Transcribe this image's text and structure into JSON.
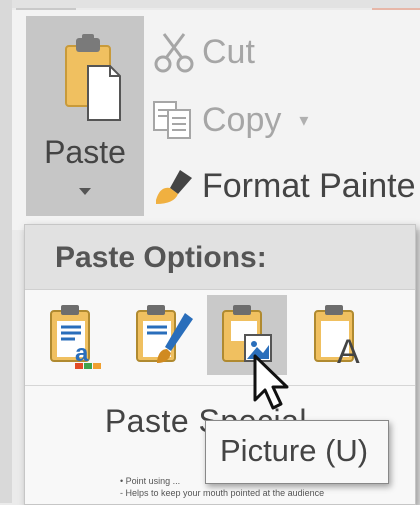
{
  "clipboard": {
    "paste_label": "Paste",
    "cut_label": "Cut",
    "copy_label": "Copy",
    "format_painter_label": "Format Painte"
  },
  "paste_menu": {
    "header": "Paste Options:",
    "options": [
      {
        "icon": "use-destination-theme-icon"
      },
      {
        "icon": "keep-source-formatting-icon"
      },
      {
        "icon": "picture-icon",
        "selected": true
      },
      {
        "icon": "keep-text-only-icon"
      }
    ],
    "paste_special_label": "Paste Special..."
  },
  "tooltip": {
    "text": "Picture (U)"
  },
  "background_slide": {
    "line1": "• Point using ...",
    "line2": "- Helps to keep your mouth pointed at the audience"
  },
  "colors": {
    "ribbon_bg": "#f3f3f3",
    "paste_button_bg": "#c6c6c6",
    "menu_header_bg": "#e1e1e1",
    "selected_option_bg": "#c9c9c9",
    "clipboard_gold": "#f0c060",
    "accent_blue": "#2a6ebb"
  }
}
